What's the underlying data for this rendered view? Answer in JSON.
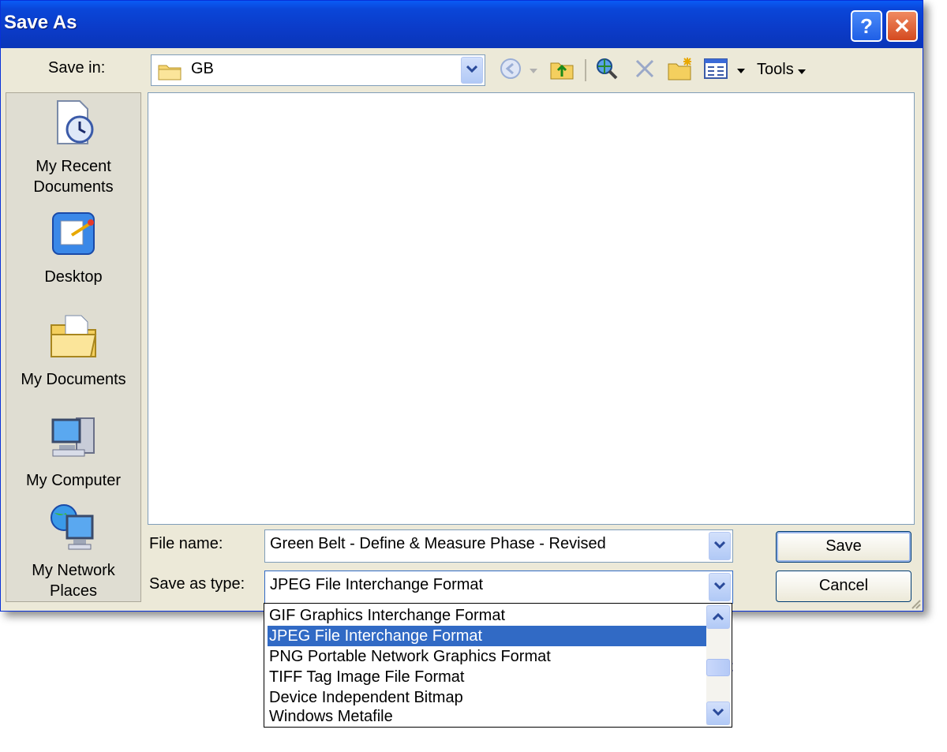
{
  "window": {
    "title": "Save As"
  },
  "toolbar": {
    "save_in_label": "Save in:",
    "save_in_value": "GB",
    "tools_label": "Tools"
  },
  "places": [
    {
      "line1": "My Recent",
      "line2": "Documents",
      "icon": "recent-documents-icon"
    },
    {
      "line1": "Desktop",
      "line2": "",
      "icon": "desktop-icon"
    },
    {
      "line1": "My Documents",
      "line2": "",
      "icon": "my-documents-icon"
    },
    {
      "line1": "My Computer",
      "line2": "",
      "icon": "my-computer-icon"
    },
    {
      "line1": "My Network",
      "line2": "Places",
      "icon": "my-network-places-icon"
    }
  ],
  "form": {
    "file_name_label": "File name:",
    "file_name_value": "Green Belt - Define & Measure Phase - Revised",
    "save_as_type_label": "Save as type:",
    "save_as_type_value": "JPEG File Interchange Format"
  },
  "buttons": {
    "save": "Save",
    "cancel": "Cancel"
  },
  "type_options": [
    "GIF Graphics Interchange Format",
    "JPEG File Interchange Format",
    "PNG Portable Network Graphics Format",
    "TIFF Tag Image File Format",
    "Device Independent Bitmap",
    "Windows Metafile"
  ],
  "selected_type_index": 1,
  "colors": {
    "titlebar": "#0a46d8",
    "selection": "#316ac5",
    "dialog_bg": "#ece9d8"
  }
}
